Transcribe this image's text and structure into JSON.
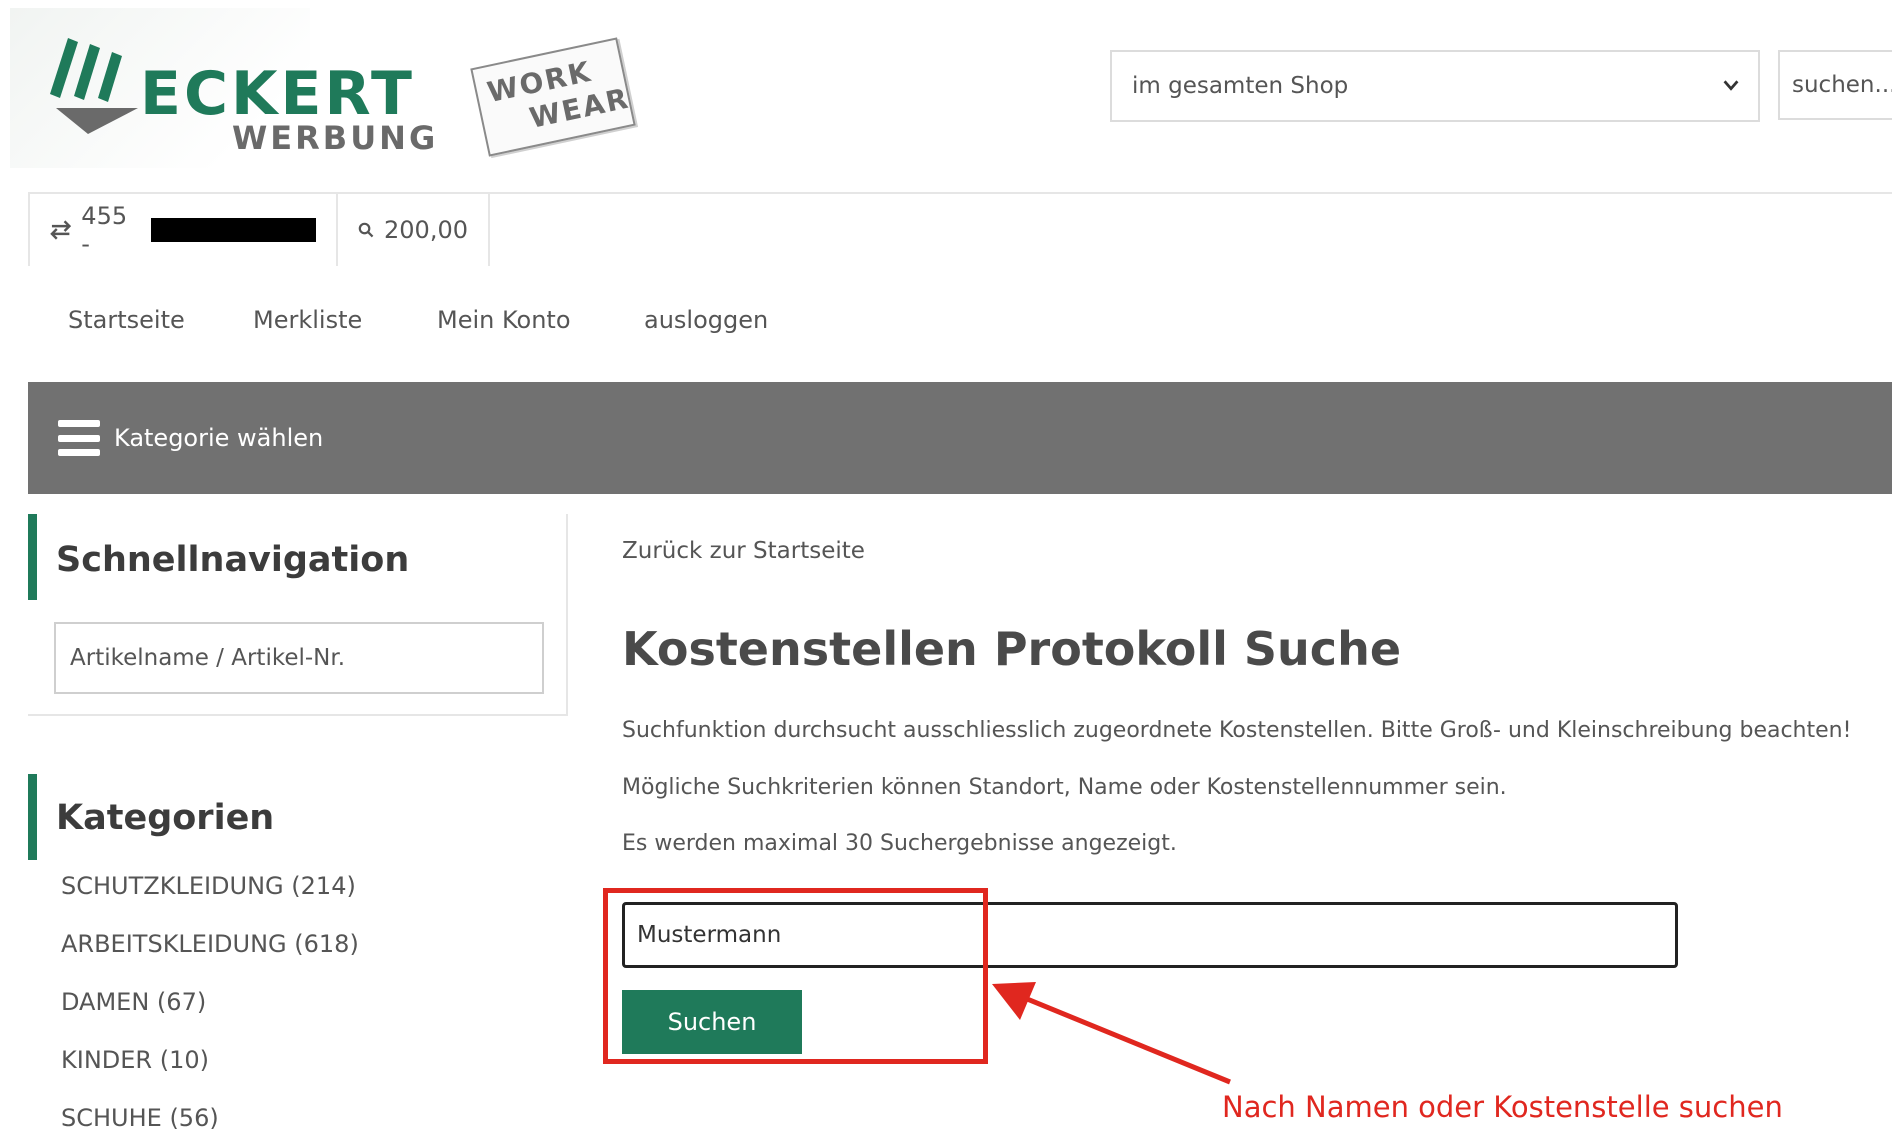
{
  "header": {
    "logo": {
      "name": "ECKERT",
      "sub": "WERBUNG",
      "tag_line1": "WORK",
      "tag_line2": "WEAR",
      "brand_color": "#1f7a5a"
    },
    "scope_select": {
      "value": "im gesamten Shop",
      "icon": "chevron-down-icon"
    },
    "search": {
      "placeholder": "suchen..."
    }
  },
  "account_bar": {
    "customer_number": "455 -",
    "switch_icon": "swap-arrows-icon",
    "budget_icon": "search-icon",
    "budget": "200,00"
  },
  "topnav": [
    {
      "label": "Startseite"
    },
    {
      "label": "Merkliste"
    },
    {
      "label": "Mein Konto"
    },
    {
      "label": "ausloggen"
    }
  ],
  "category_bar": {
    "label": "Kategorie wählen",
    "icon": "hamburger-menu-icon",
    "bg_color": "#717171"
  },
  "sidebar": {
    "quicknav": {
      "title": "Schnellnavigation",
      "placeholder": "Artikelname / Artikel-Nr."
    },
    "categories": {
      "title": "Kategorien",
      "items": [
        {
          "label": "SCHUTZKLEIDUNG (214)"
        },
        {
          "label": "ARBEITSKLEIDUNG (618)"
        },
        {
          "label": "DAMEN (67)"
        },
        {
          "label": "KINDER (10)"
        },
        {
          "label": "SCHUHE (56)"
        }
      ]
    }
  },
  "main": {
    "back_link": "Zurück zur Startseite",
    "title": "Kostenstellen Protokoll Suche",
    "info": [
      "Suchfunktion durchsucht ausschliesslich zugeordnete Kostenstellen. Bitte Groß- und Kleinschreibung beachten!",
      "Mögliche Suchkriterien können Standort, Name oder Kostenstellennummer sein.",
      "Es werden maximal 30 Suchergebnisse angezeigt."
    ],
    "search_term": "Mustermann",
    "search_button": "Suchen"
  },
  "annotation": {
    "text": "Nach Namen oder Kostenstelle suchen",
    "color": "#e0271f"
  }
}
